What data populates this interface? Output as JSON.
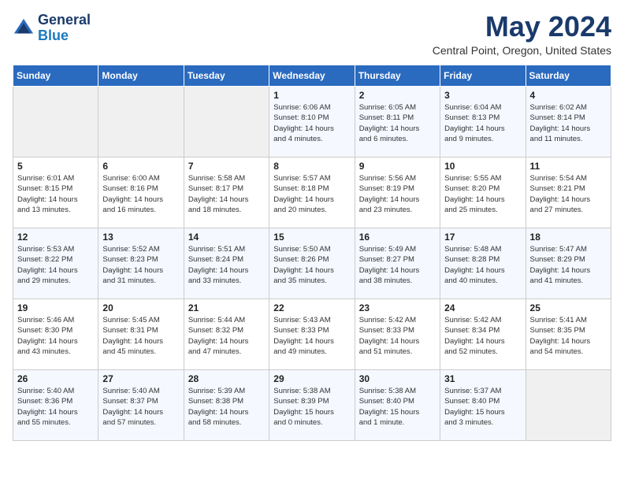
{
  "logo": {
    "line1": "General",
    "line2": "Blue"
  },
  "title": "May 2024",
  "location": "Central Point, Oregon, United States",
  "weekdays": [
    "Sunday",
    "Monday",
    "Tuesday",
    "Wednesday",
    "Thursday",
    "Friday",
    "Saturday"
  ],
  "weeks": [
    [
      {
        "day": "",
        "info": ""
      },
      {
        "day": "",
        "info": ""
      },
      {
        "day": "",
        "info": ""
      },
      {
        "day": "1",
        "info": "Sunrise: 6:06 AM\nSunset: 8:10 PM\nDaylight: 14 hours\nand 4 minutes."
      },
      {
        "day": "2",
        "info": "Sunrise: 6:05 AM\nSunset: 8:11 PM\nDaylight: 14 hours\nand 6 minutes."
      },
      {
        "day": "3",
        "info": "Sunrise: 6:04 AM\nSunset: 8:13 PM\nDaylight: 14 hours\nand 9 minutes."
      },
      {
        "day": "4",
        "info": "Sunrise: 6:02 AM\nSunset: 8:14 PM\nDaylight: 14 hours\nand 11 minutes."
      }
    ],
    [
      {
        "day": "5",
        "info": "Sunrise: 6:01 AM\nSunset: 8:15 PM\nDaylight: 14 hours\nand 13 minutes."
      },
      {
        "day": "6",
        "info": "Sunrise: 6:00 AM\nSunset: 8:16 PM\nDaylight: 14 hours\nand 16 minutes."
      },
      {
        "day": "7",
        "info": "Sunrise: 5:58 AM\nSunset: 8:17 PM\nDaylight: 14 hours\nand 18 minutes."
      },
      {
        "day": "8",
        "info": "Sunrise: 5:57 AM\nSunset: 8:18 PM\nDaylight: 14 hours\nand 20 minutes."
      },
      {
        "day": "9",
        "info": "Sunrise: 5:56 AM\nSunset: 8:19 PM\nDaylight: 14 hours\nand 23 minutes."
      },
      {
        "day": "10",
        "info": "Sunrise: 5:55 AM\nSunset: 8:20 PM\nDaylight: 14 hours\nand 25 minutes."
      },
      {
        "day": "11",
        "info": "Sunrise: 5:54 AM\nSunset: 8:21 PM\nDaylight: 14 hours\nand 27 minutes."
      }
    ],
    [
      {
        "day": "12",
        "info": "Sunrise: 5:53 AM\nSunset: 8:22 PM\nDaylight: 14 hours\nand 29 minutes."
      },
      {
        "day": "13",
        "info": "Sunrise: 5:52 AM\nSunset: 8:23 PM\nDaylight: 14 hours\nand 31 minutes."
      },
      {
        "day": "14",
        "info": "Sunrise: 5:51 AM\nSunset: 8:24 PM\nDaylight: 14 hours\nand 33 minutes."
      },
      {
        "day": "15",
        "info": "Sunrise: 5:50 AM\nSunset: 8:26 PM\nDaylight: 14 hours\nand 35 minutes."
      },
      {
        "day": "16",
        "info": "Sunrise: 5:49 AM\nSunset: 8:27 PM\nDaylight: 14 hours\nand 38 minutes."
      },
      {
        "day": "17",
        "info": "Sunrise: 5:48 AM\nSunset: 8:28 PM\nDaylight: 14 hours\nand 40 minutes."
      },
      {
        "day": "18",
        "info": "Sunrise: 5:47 AM\nSunset: 8:29 PM\nDaylight: 14 hours\nand 41 minutes."
      }
    ],
    [
      {
        "day": "19",
        "info": "Sunrise: 5:46 AM\nSunset: 8:30 PM\nDaylight: 14 hours\nand 43 minutes."
      },
      {
        "day": "20",
        "info": "Sunrise: 5:45 AM\nSunset: 8:31 PM\nDaylight: 14 hours\nand 45 minutes."
      },
      {
        "day": "21",
        "info": "Sunrise: 5:44 AM\nSunset: 8:32 PM\nDaylight: 14 hours\nand 47 minutes."
      },
      {
        "day": "22",
        "info": "Sunrise: 5:43 AM\nSunset: 8:33 PM\nDaylight: 14 hours\nand 49 minutes."
      },
      {
        "day": "23",
        "info": "Sunrise: 5:42 AM\nSunset: 8:33 PM\nDaylight: 14 hours\nand 51 minutes."
      },
      {
        "day": "24",
        "info": "Sunrise: 5:42 AM\nSunset: 8:34 PM\nDaylight: 14 hours\nand 52 minutes."
      },
      {
        "day": "25",
        "info": "Sunrise: 5:41 AM\nSunset: 8:35 PM\nDaylight: 14 hours\nand 54 minutes."
      }
    ],
    [
      {
        "day": "26",
        "info": "Sunrise: 5:40 AM\nSunset: 8:36 PM\nDaylight: 14 hours\nand 55 minutes."
      },
      {
        "day": "27",
        "info": "Sunrise: 5:40 AM\nSunset: 8:37 PM\nDaylight: 14 hours\nand 57 minutes."
      },
      {
        "day": "28",
        "info": "Sunrise: 5:39 AM\nSunset: 8:38 PM\nDaylight: 14 hours\nand 58 minutes."
      },
      {
        "day": "29",
        "info": "Sunrise: 5:38 AM\nSunset: 8:39 PM\nDaylight: 15 hours\nand 0 minutes."
      },
      {
        "day": "30",
        "info": "Sunrise: 5:38 AM\nSunset: 8:40 PM\nDaylight: 15 hours\nand 1 minute."
      },
      {
        "day": "31",
        "info": "Sunrise: 5:37 AM\nSunset: 8:40 PM\nDaylight: 15 hours\nand 3 minutes."
      },
      {
        "day": "",
        "info": ""
      }
    ]
  ]
}
